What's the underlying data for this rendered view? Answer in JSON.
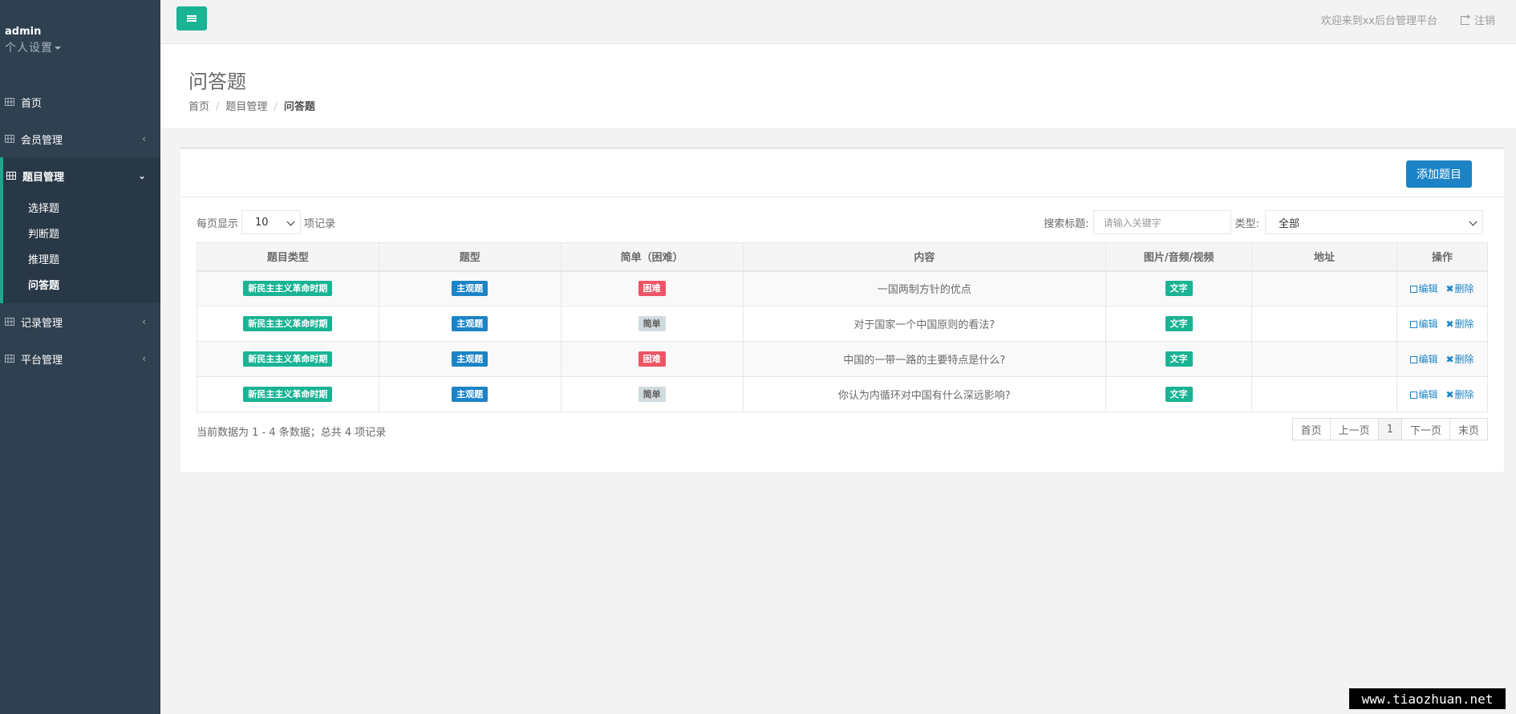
{
  "user": {
    "name": "admin",
    "settings_label": "个人设置"
  },
  "sidebar": {
    "items": [
      {
        "label": "首页",
        "icon": "table-icon"
      },
      {
        "label": "会员管理",
        "icon": "table-icon"
      },
      {
        "label": "题目管理",
        "icon": "table-icon",
        "children": [
          "选择题",
          "判断题",
          "推理题",
          "问答题"
        ]
      },
      {
        "label": "记录管理",
        "icon": "table-icon"
      },
      {
        "label": "平台管理",
        "icon": "table-icon"
      }
    ]
  },
  "topbar": {
    "welcome": "欢迎来到xx后台管理平台",
    "logout": "注销"
  },
  "page": {
    "title": "问答题",
    "breadcrumb": [
      "首页",
      "题目管理",
      "问答题"
    ]
  },
  "toolbar": {
    "add_button": "添加题目",
    "per_page_prefix": "每页显示",
    "per_page_value": "10",
    "per_page_suffix": "项记录",
    "search_label": "搜索标题:",
    "search_placeholder": "请输入关键字",
    "type_label": "类型:",
    "type_value": "全部"
  },
  "table": {
    "headers": [
      "题目类型",
      "题型",
      "简单（困难）",
      "内容",
      "图片/音频/视频",
      "地址",
      "操作"
    ],
    "rows": [
      {
        "category": "新民主主义革命时期",
        "qtype": "主观题",
        "difficulty": "困难",
        "content": "一国两制方针的优点",
        "media": "文字",
        "address": ""
      },
      {
        "category": "新民主主义革命时期",
        "qtype": "主观题",
        "difficulty": "简单",
        "content": "对于国家一个中国原则的看法?",
        "media": "文字",
        "address": ""
      },
      {
        "category": "新民主主义革命时期",
        "qtype": "主观题",
        "difficulty": "困难",
        "content": "中国的一带一路的主要特点是什么?",
        "media": "文字",
        "address": ""
      },
      {
        "category": "新民主主义革命时期",
        "qtype": "主观题",
        "difficulty": "简单",
        "content": "你认为内循环对中国有什么深远影响?",
        "media": "文字",
        "address": ""
      }
    ],
    "edit_label": "编辑",
    "delete_label": "删除"
  },
  "footer": {
    "summary": "当前数据为 1 - 4 条数据；总共 4 项记录",
    "pager": [
      "首页",
      "上一页",
      "1",
      "下一页",
      "末页"
    ]
  },
  "watermark": "www.tiaozhuan.net",
  "colors": {
    "sidebar": "#2f4050",
    "primary": "#1ab394",
    "info": "#1c84c6",
    "danger": "#ed5565"
  }
}
